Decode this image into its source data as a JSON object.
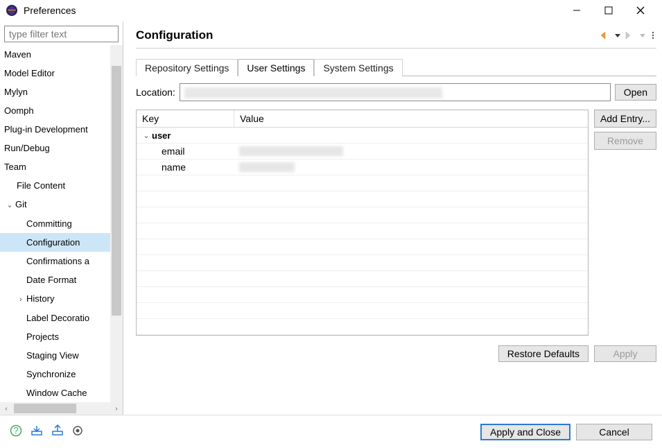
{
  "window": {
    "title": "Preferences"
  },
  "filter": {
    "placeholder": "type filter text"
  },
  "tree": {
    "items": [
      {
        "label": "Maven",
        "indent": 0
      },
      {
        "label": "Model Editor",
        "indent": 0
      },
      {
        "label": "Mylyn",
        "indent": 0
      },
      {
        "label": "Oomph",
        "indent": 0
      },
      {
        "label": "Plug-in Development",
        "indent": 0
      },
      {
        "label": "Run/Debug",
        "indent": 0
      },
      {
        "label": "Team",
        "indent": 0
      },
      {
        "label": "File Content",
        "indent": 1
      },
      {
        "label": "Git",
        "indent": 1,
        "expanded": true
      },
      {
        "label": "Committing",
        "indent": 2
      },
      {
        "label": "Configuration",
        "indent": 2,
        "selected": true
      },
      {
        "label": "Confirmations a",
        "indent": 2
      },
      {
        "label": "Date Format",
        "indent": 2
      },
      {
        "label": "History",
        "indent": 2,
        "hasChildren": true
      },
      {
        "label": "Label Decoratio",
        "indent": 2
      },
      {
        "label": "Projects",
        "indent": 2
      },
      {
        "label": "Staging View",
        "indent": 2
      },
      {
        "label": "Synchronize",
        "indent": 2
      },
      {
        "label": "Window Cache",
        "indent": 2
      }
    ]
  },
  "page": {
    "title": "Configuration",
    "tabs": [
      "Repository Settings",
      "User Settings",
      "System Settings"
    ],
    "activeTab": 1,
    "locationLabel": "Location:",
    "openLabel": "Open",
    "table": {
      "headers": {
        "key": "Key",
        "value": "Value"
      },
      "group": "user",
      "rows": [
        {
          "key": "email",
          "value": ""
        },
        {
          "key": "name",
          "value": ""
        }
      ]
    },
    "actions": {
      "add": "Add Entry...",
      "remove": "Remove"
    },
    "footer": {
      "restore": "Restore Defaults",
      "apply": "Apply"
    }
  },
  "dialog": {
    "applyClose": "Apply and Close",
    "cancel": "Cancel"
  }
}
